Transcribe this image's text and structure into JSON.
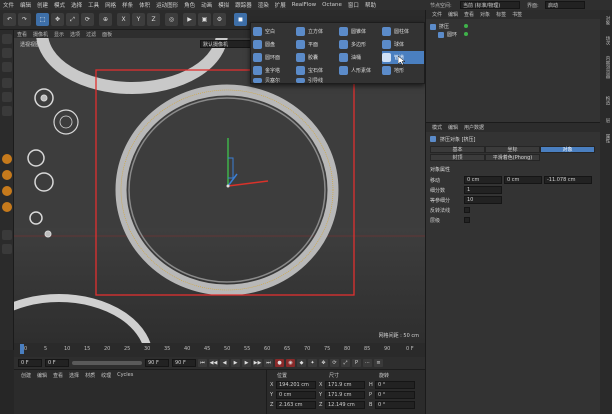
{
  "menubar": {
    "items": [
      "文件",
      "编辑",
      "创建",
      "模式",
      "选择",
      "工具",
      "网格",
      "样条",
      "体积",
      "运动图形",
      "角色",
      "动画",
      "模拟",
      "跟踪器",
      "渲染",
      "扩展",
      "RealFlow",
      "Octane",
      "窗口",
      "帮助"
    ],
    "layout_label": "界面:",
    "layout_value": "启动",
    "node_space_label": "节点空间:",
    "node_space_value": "当前 (标准/物理)"
  },
  "toolbar": {
    "icons": [
      "undo-icon",
      "redo-icon",
      "select-icon",
      "move-icon",
      "scale-icon",
      "rotate-icon",
      "x-axis-icon",
      "y-axis-icon",
      "z-axis-icon",
      "coord-icon",
      "cube-icon"
    ],
    "axis_labels": [
      "X",
      "Y",
      "Z"
    ]
  },
  "viewport": {
    "menu": [
      "查看",
      "摄像机",
      "显示",
      "选项",
      "过滤",
      "面板"
    ],
    "camera_label": "透视视图",
    "camera_dropdown": "默认摄像机",
    "grid_spacing": "网格间距 : 50 cm"
  },
  "create_popup": {
    "columns": [
      [
        "空白",
        "圆盘",
        "圆环面",
        "金字塔",
        "贝塞尔"
      ],
      [
        "立方体",
        "平面",
        "胶囊",
        "宝石体",
        "引导线"
      ],
      [
        "圆锥体",
        "多边形",
        "油桶",
        "人形素体"
      ],
      [
        "圆柱体",
        "球体",
        "管道",
        "地形"
      ]
    ],
    "highlighted": "管道"
  },
  "timeline": {
    "ticks": [
      "0",
      "5",
      "10",
      "15",
      "20",
      "25",
      "30",
      "35",
      "40",
      "45",
      "50",
      "55",
      "60",
      "65",
      "70",
      "75",
      "80",
      "85",
      "90"
    ],
    "end_frame": "0 F",
    "current_frame": "0 F",
    "min_frame": "0 F",
    "max_frame": "90 F",
    "preview_end": "90 F"
  },
  "material_panel": {
    "menu": [
      "创建",
      "编辑",
      "查看",
      "选择",
      "材质",
      "纹理",
      "Cycles"
    ]
  },
  "coords": {
    "headers": [
      "位置",
      "尺寸",
      "旋转"
    ],
    "rows": [
      {
        "axis": "X",
        "pos": "194.201 cm",
        "size_axis": "X",
        "size": "171.9 cm",
        "rot_axis": "H",
        "rot": "0 °"
      },
      {
        "axis": "Y",
        "pos": "0 cm",
        "size_axis": "Y",
        "size": "171.9 cm",
        "rot_axis": "P",
        "rot": "0 °"
      },
      {
        "axis": "Z",
        "pos": "2.163 cm",
        "size_axis": "Z",
        "size": "12.149 cm",
        "rot_axis": "B",
        "rot": "0 °"
      }
    ],
    "object_mode": "对象 (相对)",
    "size_mode": "绝对尺寸",
    "apply_label": "应用"
  },
  "object_manager": {
    "tabs": [
      "文件",
      "编辑",
      "查看",
      "对象",
      "标签",
      "书签"
    ],
    "objects": [
      "挤压",
      "圆环"
    ]
  },
  "attr_manager": {
    "tabs": [
      "模式",
      "编辑",
      "用户数据"
    ],
    "title": "挤压对象 [挤压]",
    "sub_tabs_row1": [
      "基本",
      "坐标",
      "对象"
    ],
    "sub_tabs_row2": [
      "封顶",
      "平滑着色(Phong)"
    ],
    "active_tab": "对象",
    "section_title": "对象属性",
    "props": [
      {
        "label": "移动",
        "v1": "0 cm",
        "v2": "0 cm",
        "v3": "-11.078 cm"
      },
      {
        "label": "细分数",
        "v1": "1"
      },
      {
        "label": "等参细分",
        "v1": "10"
      },
      {
        "label": "反转法线",
        "v1": ""
      },
      {
        "label": "层级",
        "v1": ""
      }
    ]
  },
  "right_strip": {
    "vtabs": [
      "对象",
      "场次",
      "内容浏览器",
      "构造",
      "层",
      "属性"
    ]
  },
  "colors": {
    "accent": "#4a7fc0",
    "selection_box": "#e0302f",
    "ring": "#c8c8c8",
    "axis_x": "#d9322a",
    "axis_y": "#3fb24a",
    "axis_z": "#3a7fd5"
  }
}
